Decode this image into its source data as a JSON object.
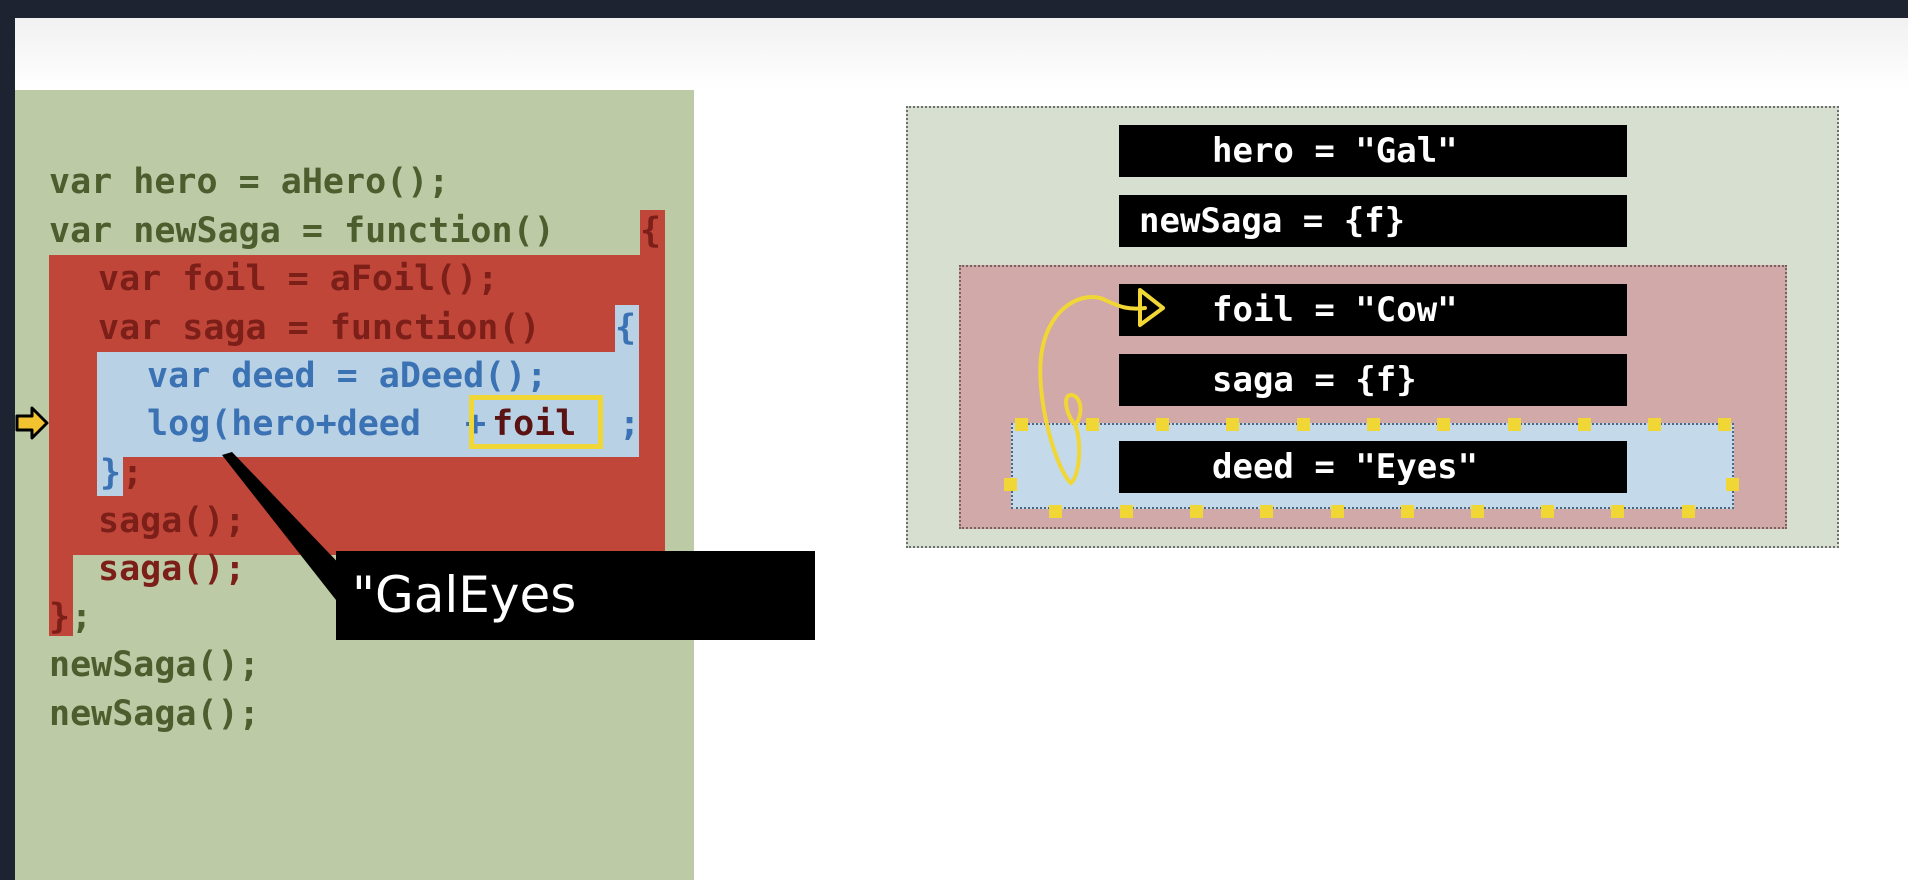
{
  "code": {
    "lines": [
      "var hero = aHero();",
      "var newSaga = function()",
      "{",
      "var foil = aFoil();",
      "var saga = function()",
      "{",
      "var deed = aDeed();",
      "log(hero+deed",
      "+",
      "foil",
      ";",
      "}",
      ";",
      "saga();",
      "saga();",
      "}",
      ";",
      "newSaga();",
      "newSaga();"
    ]
  },
  "callout": {
    "text": "\"GalEyes"
  },
  "scopes": {
    "global": [
      {
        "label": "hero = \"Gal\""
      },
      {
        "label": "newSaga = {f}"
      }
    ],
    "saga": [
      {
        "label": "foil = \"Cow\""
      },
      {
        "label": "saga = {f}"
      }
    ],
    "deed": [
      {
        "label": "deed = \"Eyes\""
      }
    ]
  },
  "colors": {
    "code_background": "#bccba6",
    "function_scope_red": "#c0463a",
    "inner_scope_blue": "#b9d1e5",
    "highlight_yellow": "#f1d735",
    "global_scope_bg": "#d6dfd0",
    "saga_scope_bg": "#d0a9a8",
    "deed_scope_bg": "#c4d9ea"
  },
  "icons": {
    "current_line_marker": "arrow-right-icon",
    "scope_lookup_arrow": "curved-arrow-icon"
  }
}
